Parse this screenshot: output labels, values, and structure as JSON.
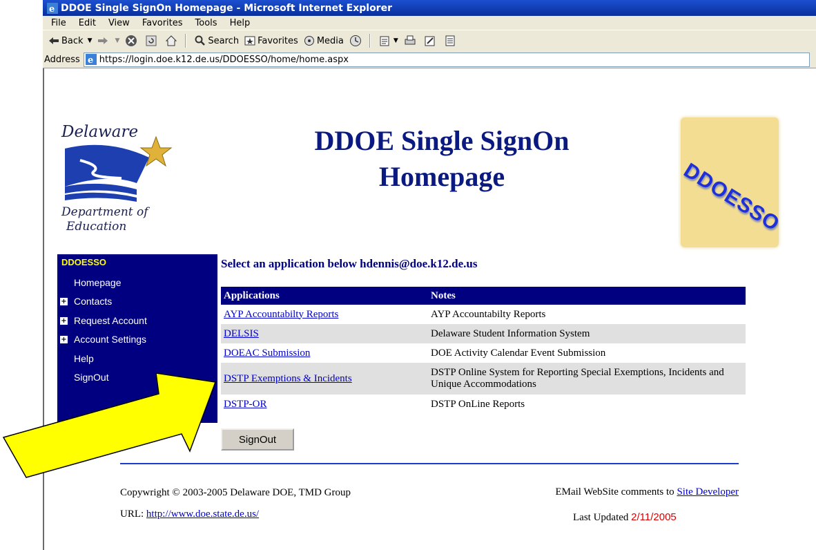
{
  "window": {
    "title": "DDOE Single SignOn Homepage - Microsoft Internet Explorer"
  },
  "menu": [
    "File",
    "Edit",
    "View",
    "Favorites",
    "Tools",
    "Help"
  ],
  "toolbar": {
    "back": "Back",
    "search": "Search",
    "favorites": "Favorites",
    "media": "Media"
  },
  "address": {
    "label": "Address",
    "url": "https://login.doe.k12.de.us/DDOESSO/home/home.aspx"
  },
  "logo": {
    "top_text": "Delaware",
    "bottom_text_1": "Department of",
    "bottom_text_2": "Education"
  },
  "header": {
    "title_line1": "DDOE Single SignOn",
    "title_line2": "Homepage",
    "badge_text": "DDOESSO"
  },
  "sidebar": {
    "title": "DDOESSO",
    "items": [
      {
        "label": "Homepage",
        "expandable": false
      },
      {
        "label": "Contacts",
        "expandable": true
      },
      {
        "label": "Request Account",
        "expandable": true
      },
      {
        "label": "Account Settings",
        "expandable": true
      },
      {
        "label": "Help",
        "expandable": false
      },
      {
        "label": "SignOut",
        "expandable": false
      }
    ]
  },
  "main": {
    "heading": "Select an application below hdennis@doe.k12.de.us",
    "table": {
      "headers": [
        "Applications",
        "Notes"
      ],
      "rows": [
        {
          "app": "AYP Accountabilty Reports",
          "note": "AYP Accountabilty Reports"
        },
        {
          "app": "DELSIS",
          "note": "Delaware Student Information System"
        },
        {
          "app": "DOEAC Submission",
          "note": "DOE Activity Calendar Event Submission"
        },
        {
          "app": "DSTP Exemptions & Incidents",
          "note": "DSTP Online System for Reporting Special Exemptions, Incidents and Unique Accommodations"
        },
        {
          "app": "DSTP-OR",
          "note": "DSTP OnLine Reports"
        }
      ]
    },
    "signout_button": "SignOut"
  },
  "footer": {
    "copyright": "Copywright © 2003-2005 Delaware DOE, TMD Group",
    "url_label": "URL:",
    "url": "http://www.doe.state.de.us/",
    "email_text": "EMail WebSite comments to",
    "email_link": "Site Developer",
    "updated_label": "Last Updated",
    "updated_date": "2/11/2005"
  },
  "colors": {
    "sidebar_bg": "#000080",
    "sidebar_title": "#ffff00",
    "header_text": "#0b1a80",
    "link": "#0000cc",
    "arrow": "#ffff00",
    "date": "#dd0000"
  }
}
